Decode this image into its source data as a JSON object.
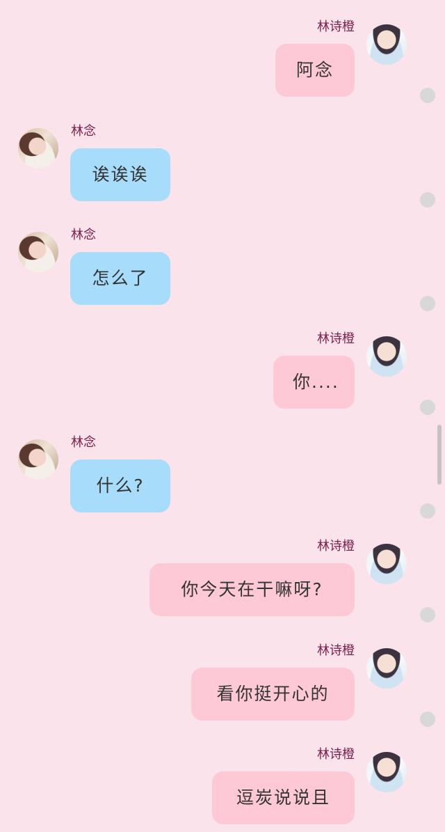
{
  "contacts": {
    "me": "林诗橙",
    "other": "林念"
  },
  "messages": [
    {
      "side": "right",
      "sender": "林诗橙",
      "text": "阿念"
    },
    {
      "side": "left",
      "sender": "林念",
      "text": "诶诶诶"
    },
    {
      "side": "left",
      "sender": "林念",
      "text": "怎么了"
    },
    {
      "side": "right",
      "sender": "林诗橙",
      "text": "你...."
    },
    {
      "side": "left",
      "sender": "林念",
      "text": "什么?"
    },
    {
      "side": "right",
      "sender": "林诗橙",
      "text": "你今天在干嘛呀?"
    },
    {
      "side": "right",
      "sender": "林诗橙",
      "text": "看你挺开心的"
    },
    {
      "side": "right",
      "sender": "林诗橙",
      "text": "逗炭说说且"
    }
  ],
  "colors": {
    "background": "#fae3ea",
    "right_bubble": "#fdc9d6",
    "left_bubble": "#a7ddfa",
    "sender_name": "#7d1b4b"
  }
}
